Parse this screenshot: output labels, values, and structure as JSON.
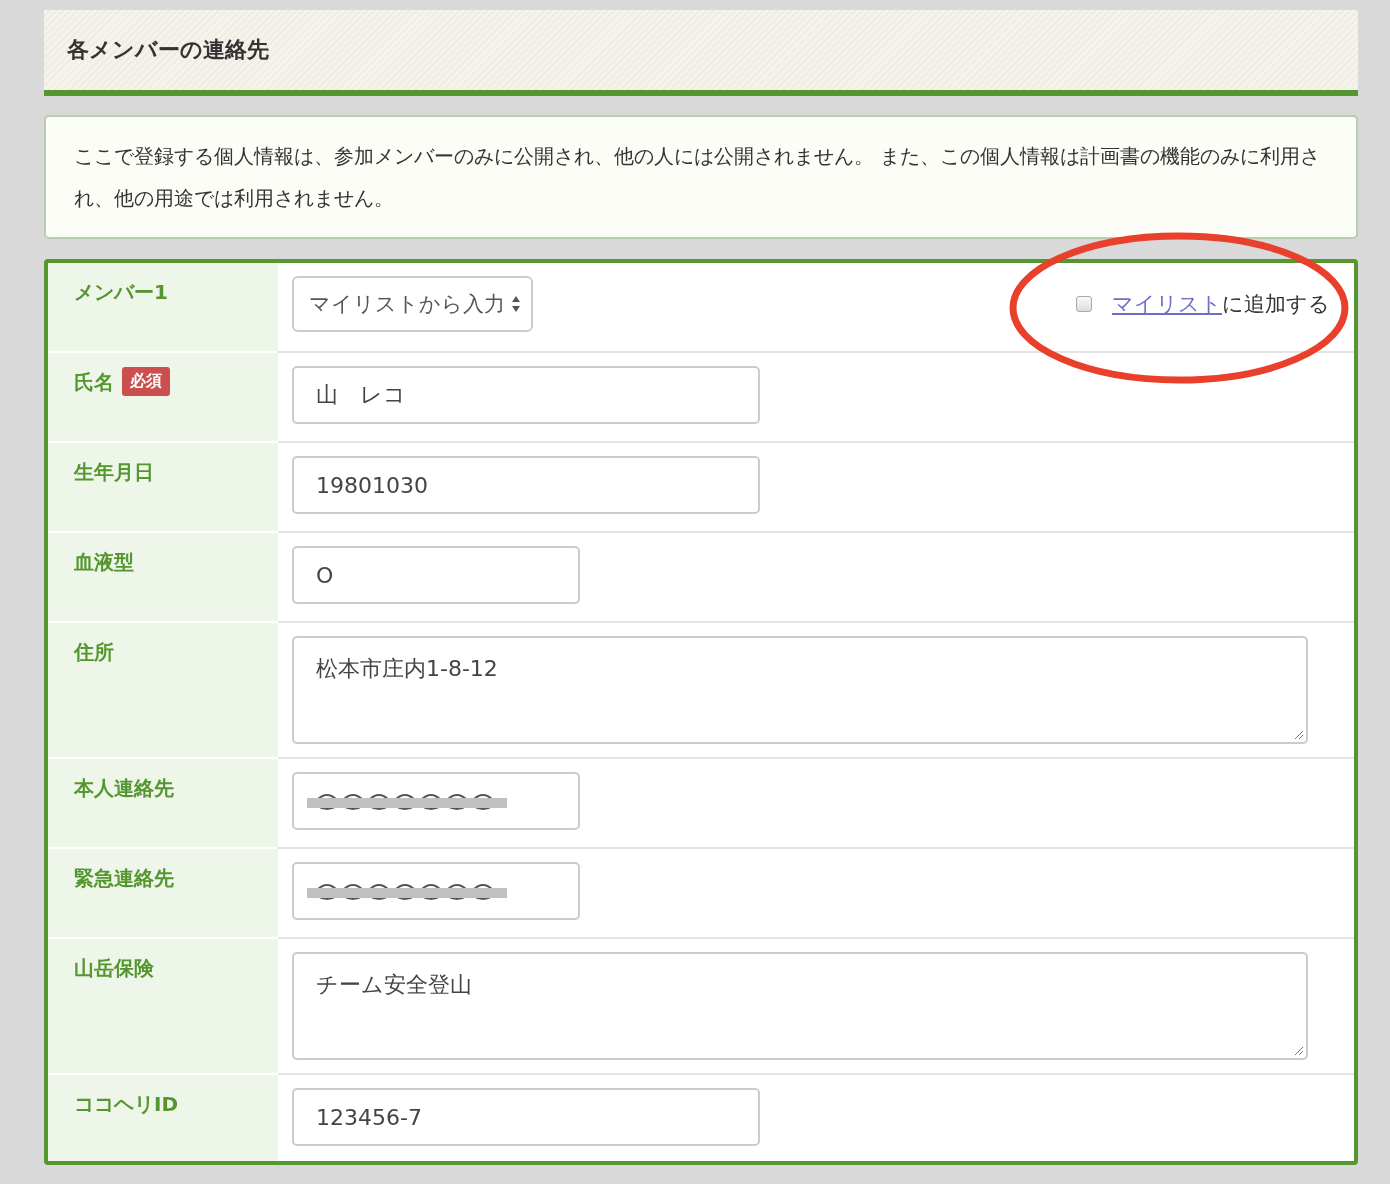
{
  "section_title": "各メンバーの連絡先",
  "notice": "ここで登録する個人情報は、参加メンバーのみに公開され、他の人には公開されません。 また、この個人情報は計画書の機能のみに利用され、他の用途では利用されません。",
  "member": {
    "label": "メンバー1",
    "select": "マイリストから入力",
    "add_checkbox": {
      "checked": false,
      "link": "マイリスト",
      "text": "に追加する"
    },
    "highlighted": true
  },
  "fields": [
    {
      "label": "氏名",
      "required_badge": "必須",
      "kind": "text",
      "value": "山　レコ"
    },
    {
      "label": "生年月日",
      "kind": "text",
      "value": "19801030"
    },
    {
      "label": "血液型",
      "kind": "short-text",
      "value": "O"
    },
    {
      "label": "住所",
      "kind": "textarea",
      "value": "松本市庄内1-8-12"
    },
    {
      "label": "本人連絡先",
      "kind": "redacted"
    },
    {
      "label": "緊急連絡先",
      "kind": "redacted"
    },
    {
      "label": "山岳保険",
      "kind": "textarea",
      "value": "チーム安全登山"
    },
    {
      "label": "ココヘリID",
      "kind": "text",
      "value": "123456-7"
    }
  ]
}
